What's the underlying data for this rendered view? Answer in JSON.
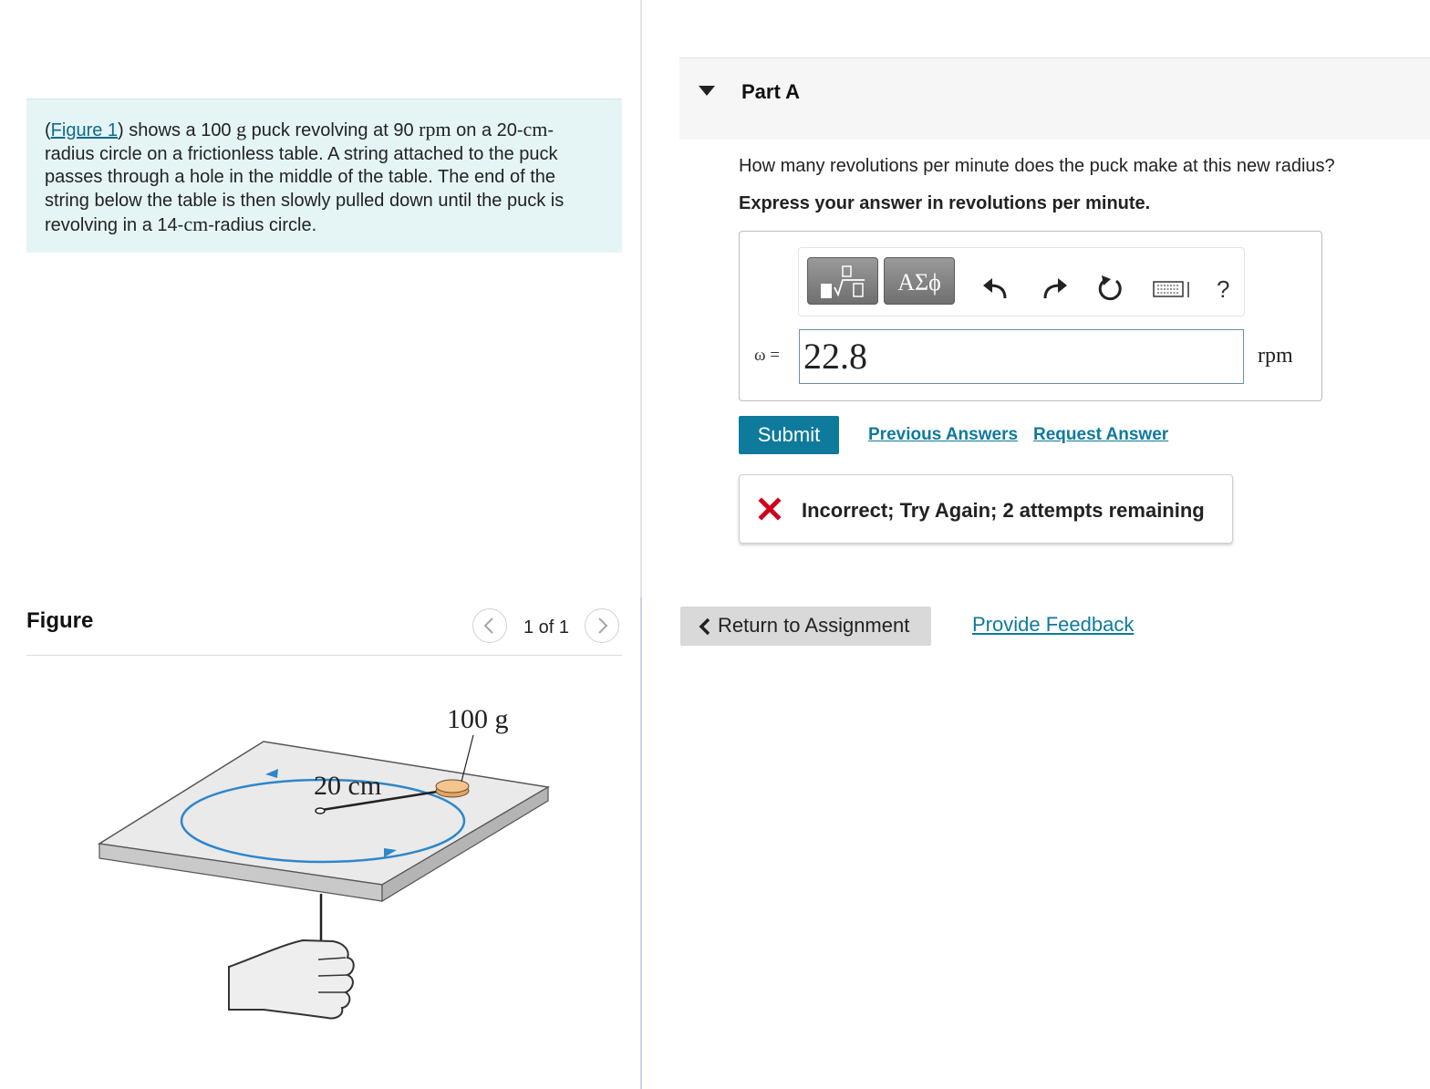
{
  "intro": {
    "paren_open": "(",
    "figure_link": "Figure 1",
    "text_1": ") shows a 100 ",
    "unit_g": "g",
    "text_2": " puck revolving at 90 ",
    "unit_rpm": "rpm",
    "text_3": " on a 20-",
    "unit_cm_1": "cm",
    "text_4": "-radius circle on a frictionless table. A string attached to the puck passes through a hole in the middle of the table. The end of the string below the table is then slowly pulled down until the puck is revolving in a 14-",
    "unit_cm_2": "cm",
    "text_5": "-radius circle."
  },
  "figure_panel": {
    "title": "Figure",
    "pager": "1 of 1",
    "prev_icon": "chevron-left-icon",
    "next_icon": "chevron-right-icon",
    "label_mass": "100 g",
    "label_radius": "20 cm",
    "circle_color": "#2f86c9",
    "puck_color": "#f3c48d"
  },
  "part": {
    "title": "Part A",
    "question": "How many revolutions per minute does the puck make at this new radius?",
    "instruction": "Express your answer in revolutions per minute."
  },
  "answer": {
    "toolbar_icons": [
      "templates-icon",
      "greek-symbols-icon",
      "undo-icon",
      "redo-icon",
      "reset-icon",
      "keyboard-icon"
    ],
    "greek_label": "ΑΣϕ",
    "help_label": "?",
    "variable_label": "ω =",
    "value": "22.8",
    "units": "rpm"
  },
  "actions": {
    "submit": "Submit",
    "previous_answers": "Previous Answers",
    "request_answer": "Request Answer"
  },
  "feedback": {
    "icon": "x-icon",
    "message": "Incorrect; Try Again; 2 attempts remaining",
    "color": "#d0021b"
  },
  "footer": {
    "return": "Return to Assignment",
    "provide_feedback": "Provide Feedback"
  },
  "colors": {
    "accent": "#0e7a9c",
    "intro_bg": "#e5f5f6"
  }
}
